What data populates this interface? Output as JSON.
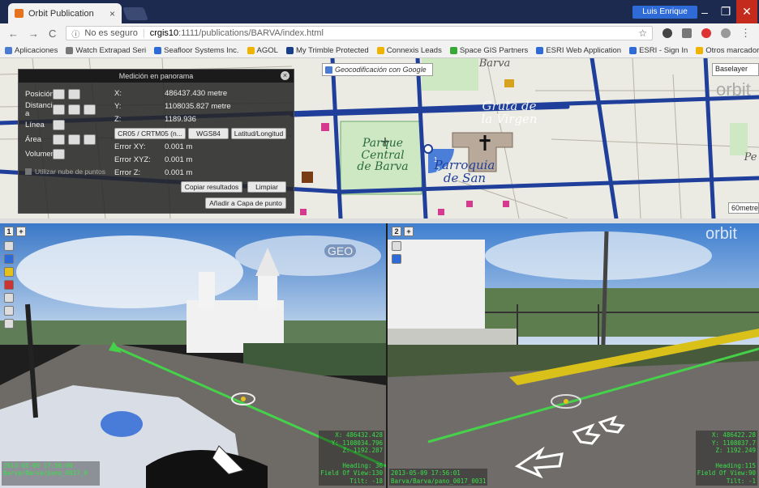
{
  "browser": {
    "tab_title": "Orbit Publication",
    "tab_close": "×",
    "user": "Luis Enrique",
    "win_min": "–",
    "win_max": "❐",
    "win_close": "✕",
    "security": "No es seguro",
    "url_host": "crgis10",
    "url_path": ":1111/publications/BARVA/index.html",
    "nav_back": "←",
    "nav_forward": "→",
    "nav_reload": "C",
    "star": "☆"
  },
  "bookmarks": [
    {
      "label": "Aplicaciones",
      "color": "#4a7bd0"
    },
    {
      "label": "Watch Extrapad Seri",
      "color": "#777777"
    },
    {
      "label": "Seafloor Systems Inc.",
      "color": "#2f6bd6"
    },
    {
      "label": "AGOL",
      "color": "#f0b400"
    },
    {
      "label": "My Trimble Protected",
      "color": "#1a3f8a"
    },
    {
      "label": "Connexis Leads",
      "color": "#f0b400"
    },
    {
      "label": "Space GIS Partners",
      "color": "#38a838"
    },
    {
      "label": "ESRI Web Application",
      "color": "#2f6bd6"
    },
    {
      "label": "ESRI - Sign In",
      "color": "#2f6bd6"
    },
    {
      "label": "Otros marcadores",
      "color": "#f0b400"
    }
  ],
  "map": {
    "geocode_label": "Geocodificación con Google",
    "baselayer_label": "Baselayer",
    "scale_label": "60metre",
    "labels": {
      "parque": "Parque\nCentral\nde Barva",
      "parroquia": "Parroquia\nde San",
      "gruta": "Gruta de\nla Virgen",
      "barva": "Barva",
      "pe": "Pe"
    },
    "marker_labels": [
      "1",
      "2"
    ]
  },
  "measure_panel": {
    "title": "Medición en panorama",
    "close": "×",
    "tools": [
      "Posición",
      "Distanci a",
      "Línea",
      "Área",
      "Volumen"
    ],
    "x_label": "X:",
    "x_value": "486437.430 metre",
    "y_label": "Y:",
    "y_value": "1108035.827 metre",
    "z_label": "Z:",
    "z_value": "1189.936",
    "crs_buttons": [
      "CR05 / CRTM05 (n...",
      "WGS84",
      "Latitud/Longitud"
    ],
    "err_xy_label": "Error XY:",
    "err_xy_value": "0.001 m",
    "err_xyz_label": "Error XYZ:",
    "err_xyz_value": "0.001 m",
    "err_z_label": "Error Z:",
    "err_z_value": "0.001 m",
    "snap_label": "Utilizar nube de puntos",
    "copy_button": "Copiar resultados",
    "clear_button": "Limpiar",
    "add_button": "Añadir a Capa de punto"
  },
  "pano1": {
    "number": "1",
    "add": "+",
    "hud_right": "X: 486432.428\nY: 1108034.796\nZ: 1192.287\n\nHeading: 36\nField Of View:130\nTilt: -18",
    "hud_left": "2013-05-09 17:56:00\nBarva/Barva/pano_0017_0\n                          "
  },
  "pano2": {
    "number": "2",
    "add": "+",
    "hud_right": "X: 486422.28\nY: 1108037.7\nZ: 1192.249\n\nHeading:115\nField Of View:90\nTilt: -1",
    "hud_left": "2013-05-09 17:56:01\nBarva/Barva/pano_0017_0031"
  },
  "logos": {
    "orbit": "orbit",
    "geo": "GEO"
  },
  "colors": {
    "road": "#1f3f9a",
    "park": "#cfe8c4",
    "accent": "#2f6bd6",
    "hud": "#39e04a"
  }
}
